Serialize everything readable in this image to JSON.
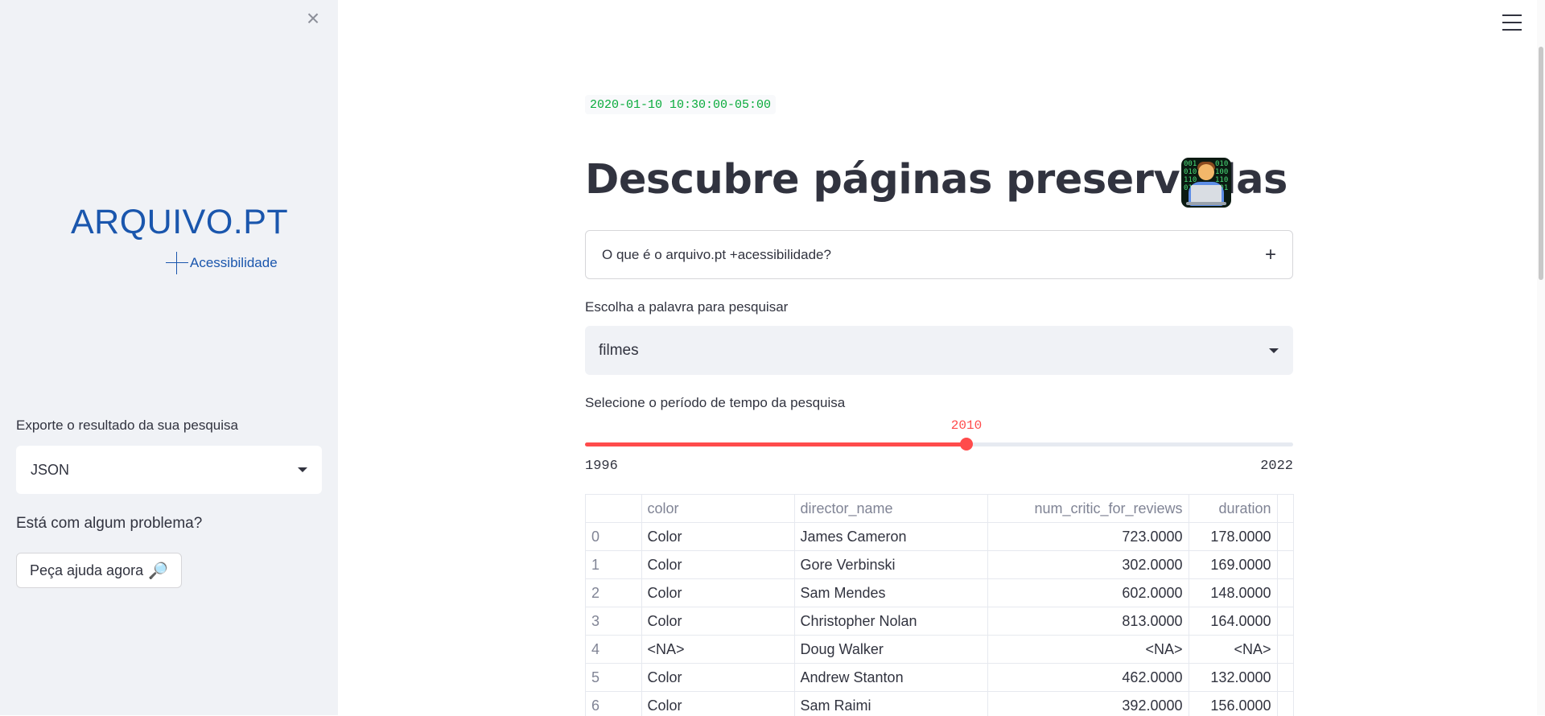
{
  "sidebar": {
    "close_symbol": "×",
    "logo_text": "ARQUIVO.PT",
    "logo_subtitle": "Acessibilidade",
    "export_label": "Exporte o resultado da sua pesquisa",
    "export_value": "JSON",
    "problem_label": "Está com algum problema?",
    "help_button_label": "Peça ajuda agora",
    "help_icon": "🔎"
  },
  "main": {
    "date_code": "2020-01-10 10:30:00-05:00",
    "title": "Descubre páginas preservadas",
    "title_icon": "technologist-icon",
    "expander_label": "O que é o arquivo.pt +acessibilidade?",
    "expander_symbol": "+",
    "search_label": "Escolha a palavra para pesquisar",
    "search_value": "filmes",
    "period_label": "Selecione o período de tempo da pesquisa",
    "slider": {
      "min": 1996,
      "max": 2022,
      "value": 2010,
      "value_text": "2010",
      "min_text": "1996",
      "max_text": "2022"
    }
  },
  "table": {
    "columns": [
      "",
      "color",
      "director_name",
      "num_critic_for_reviews",
      "duration"
    ],
    "rows": [
      [
        "0",
        "Color",
        "James Cameron",
        "723.0000",
        "178.0000"
      ],
      [
        "1",
        "Color",
        "Gore Verbinski",
        "302.0000",
        "169.0000"
      ],
      [
        "2",
        "Color",
        "Sam Mendes",
        "602.0000",
        "148.0000"
      ],
      [
        "3",
        "Color",
        "Christopher Nolan",
        "813.0000",
        "164.0000"
      ],
      [
        "4",
        "<NA>",
        "Doug Walker",
        "<NA>",
        "<NA>"
      ],
      [
        "5",
        "Color",
        "Andrew Stanton",
        "462.0000",
        "132.0000"
      ],
      [
        "6",
        "Color",
        "Sam Raimi",
        "392.0000",
        "156.0000"
      ]
    ]
  },
  "colors": {
    "accent": "#ff4b4b",
    "logo_blue": "#1a56ad",
    "sidebar_bg": "#f0f2f6",
    "code_green": "#09ab3b"
  }
}
